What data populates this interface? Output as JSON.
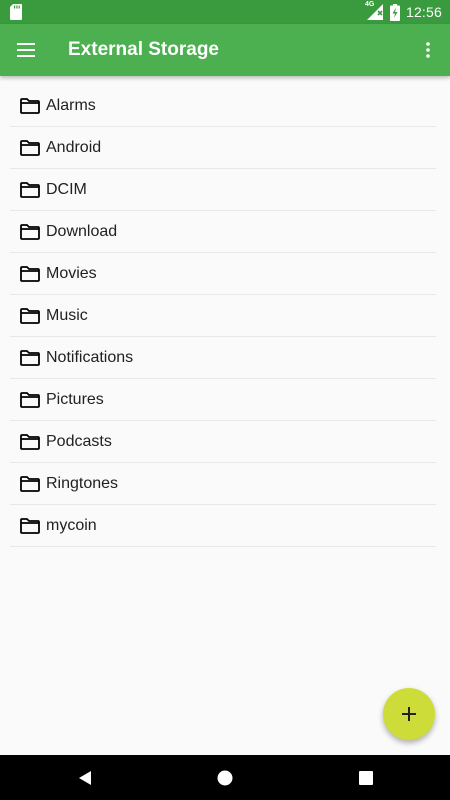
{
  "status_bar": {
    "time": "12:56",
    "network": "4G",
    "icons": [
      "sd-card-icon",
      "signal-icon",
      "battery-charging-icon"
    ]
  },
  "app_bar": {
    "title": "External Storage",
    "menu_icon": "hamburger-menu-icon",
    "overflow_icon": "more-vert-icon",
    "color": "#4caf50"
  },
  "folders": [
    {
      "name": "Alarms"
    },
    {
      "name": "Android"
    },
    {
      "name": "DCIM"
    },
    {
      "name": "Download"
    },
    {
      "name": "Movies"
    },
    {
      "name": "Music"
    },
    {
      "name": "Notifications"
    },
    {
      "name": "Pictures"
    },
    {
      "name": "Podcasts"
    },
    {
      "name": "Ringtones"
    },
    {
      "name": "mycoin"
    }
  ],
  "fab": {
    "icon": "plus-icon",
    "color": "#cddc39"
  },
  "nav_bar": {
    "buttons": [
      "back-icon",
      "home-icon",
      "recents-icon"
    ]
  }
}
